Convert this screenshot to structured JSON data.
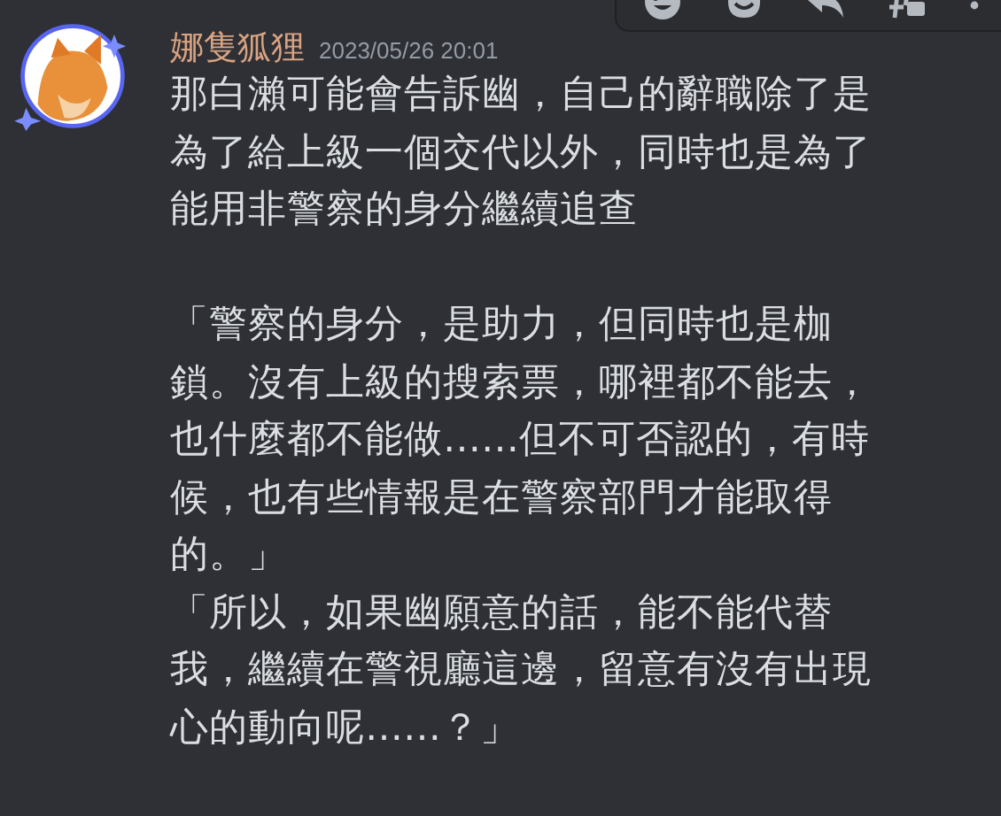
{
  "message": {
    "author": "娜隻狐狸",
    "timestamp": "2023/05/26 20:01",
    "blocks": [
      {
        "lines": [
          "那白瀨可能會告訴幽，自己的辭職除了是",
          "為了給上級一個交代以外，同時也是為了",
          "能用非警察的身分繼續追查"
        ]
      },
      {
        "lines": [
          "「警察的身分，是助力，但同時也是枷",
          "鎖。沒有上級的搜索票，哪裡都不能去，",
          "也什麼都不能做……但不可否認的，有時",
          "候，也有些情報是在警察部門才能取得",
          "的。」",
          "「所以，如果幽願意的話，能不能代替",
          "我，繼續在警視廳這邊，留意有沒有出現",
          "心的動向呢……？」"
        ]
      }
    ]
  },
  "toolbar": [
    {
      "kind": "face"
    },
    {
      "kind": "sticker"
    },
    {
      "kind": "reply"
    },
    {
      "kind": "thread"
    },
    {
      "kind": "more"
    }
  ]
}
